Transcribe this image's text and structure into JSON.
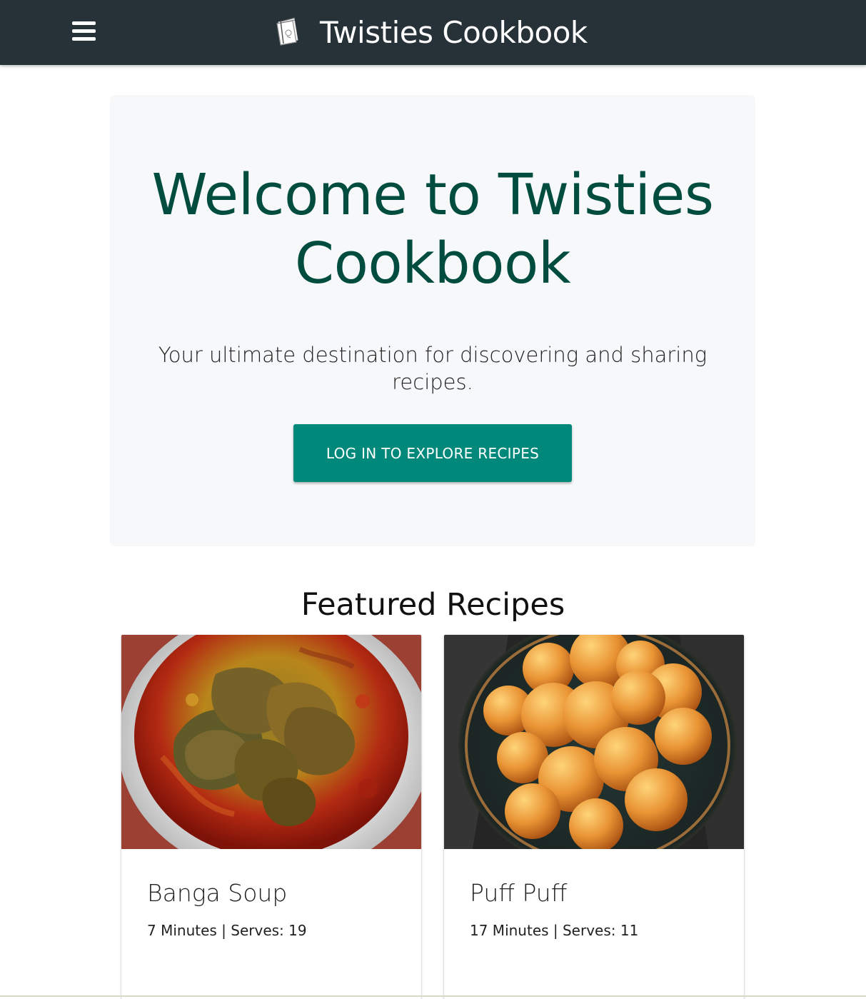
{
  "header": {
    "brand_title": "Twisties Cookbook",
    "menu_icon": "hamburger-menu-icon",
    "logo_icon": "cookbook-logo-icon",
    "background_color": "#263238"
  },
  "hero": {
    "title": "Welcome to Twisties Cookbook",
    "subtitle": "Your ultimate destination for discovering and sharing recipes.",
    "cta_label": "LOG IN TO EXPLORE RECIPES",
    "title_color": "#004d40",
    "cta_color": "#00897b",
    "background_color": "#f7f8fa"
  },
  "featured": {
    "heading": "Featured Recipes",
    "recipes": [
      {
        "name": "Banga Soup",
        "meta": "7 Minutes | Serves: 19",
        "image_icon": "banga-soup-photo"
      },
      {
        "name": "Puff Puff",
        "meta": "17 Minutes | Serves: 11",
        "image_icon": "puff-puff-photo"
      }
    ]
  }
}
